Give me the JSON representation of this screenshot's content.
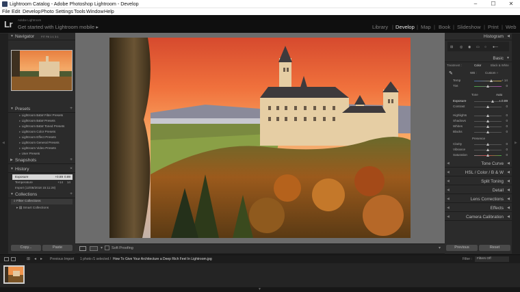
{
  "window": {
    "title": "Lightroom Catalog - Adobe Photoshop Lightroom - Develop",
    "minimize": "–",
    "maximize": "☐",
    "close": "✕"
  },
  "menu": [
    "File",
    "Edit",
    "Develop",
    "Photo",
    "Settings",
    "Tools",
    "Window",
    "Help"
  ],
  "identity": {
    "logo": "Lr",
    "sub": "Adobe Lightroom",
    "main": "Get started with Lightroom mobile ▸"
  },
  "modules": [
    "Library",
    "Develop",
    "Map",
    "Book",
    "Slideshow",
    "Print",
    "Web"
  ],
  "active_module": "Develop",
  "left": {
    "navigator": {
      "label": "Navigator",
      "modes": "FIT  Fill  1:1  3:1"
    },
    "presets": {
      "label": "Presets",
      "plus": "+",
      "items": [
        "Lightroom B&W Filter Presets",
        "Lightroom B&W Presets",
        "Lightroom B&W Toned Presets",
        "Lightroom Color Presets",
        "Lightroom Effect Presets",
        "Lightroom General Presets",
        "Lightroom Video Presets",
        "User Presets"
      ]
    },
    "snapshots": {
      "label": "Snapshots",
      "plus": "+"
    },
    "history": {
      "label": "History",
      "clear": "×",
      "items": [
        {
          "name": "Exposure",
          "v1": "+0.89",
          "v2": "0.89"
        },
        {
          "name": "Temperature",
          "v1": "+14",
          "v2": "14"
        },
        {
          "name": "Import (12/08/2018 15:11:28)",
          "v1": "",
          "v2": ""
        }
      ]
    },
    "collections": {
      "label": "Collections",
      "plus": "+",
      "filter": "Filter Collections",
      "smart": "Smart Collections"
    },
    "copy_label": "Copy...",
    "paste_label": "Paste"
  },
  "right": {
    "histogram": "Histogram",
    "basic": "Basic",
    "treatment": {
      "label": "Treatment :",
      "color": "Color",
      "bw": "Black & White"
    },
    "wb": {
      "label": "WB :",
      "value": "Custom ÷"
    },
    "temp": {
      "label": "Temp",
      "value": "+ 14"
    },
    "tint": {
      "label": "Tint",
      "value": "0"
    },
    "tone": {
      "label": "Tone",
      "auto": "Auto"
    },
    "exposure": {
      "label": "Exposure",
      "value": "+ 0.89"
    },
    "contrast": {
      "label": "Contrast",
      "value": "0"
    },
    "highlights": {
      "label": "Highlights",
      "value": "0"
    },
    "shadows": {
      "label": "Shadows",
      "value": "0"
    },
    "whites": {
      "label": "Whites",
      "value": "0"
    },
    "blacks": {
      "label": "Blacks",
      "value": "0"
    },
    "presence": "Presence",
    "clarity": {
      "label": "Clarity",
      "value": "0"
    },
    "vibrance": {
      "label": "Vibrance",
      "value": "0"
    },
    "saturation": {
      "label": "Saturation",
      "value": "0"
    },
    "panels": [
      "Tone Curve",
      "HSL  /  Color  /  B & W",
      "Split Toning",
      "Detail",
      "Lens Corrections",
      "Effects",
      "Camera Calibration"
    ],
    "previous": "Previous",
    "reset": "Reset"
  },
  "toolbar": {
    "soft_proofing": "Soft Proofing"
  },
  "filmhead": {
    "previous_import": "Previous Import",
    "count": "1 photo /1 selected /",
    "filename": "How To Give Your Architecture a Deep Rich Feel In Lightroom.jpg",
    "filter_label": "Filter :",
    "filter_value": "Filters Off"
  },
  "colors": {
    "accent": "#e8e8e8",
    "panel": "#2b2b2b",
    "canvas": "#6c6c6c"
  }
}
